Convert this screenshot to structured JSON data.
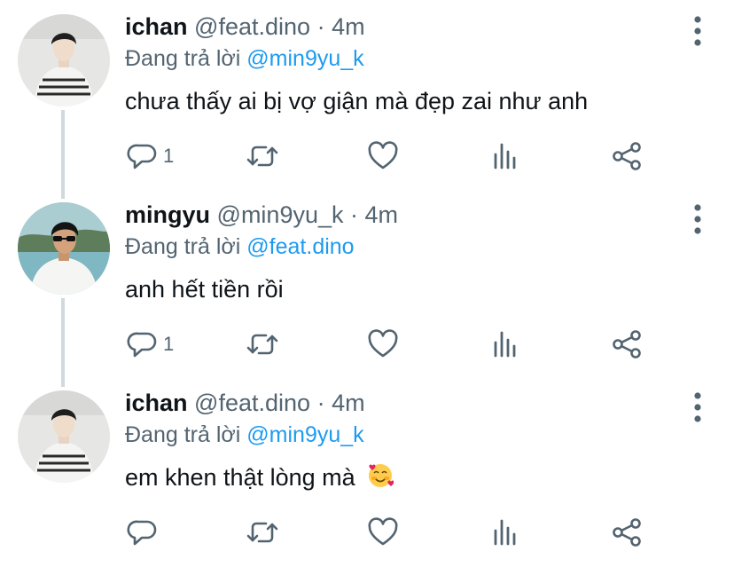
{
  "colors": {
    "text": "#0f1419",
    "muted": "#536471",
    "link": "#1d9bf0",
    "thread_line": "#cfd9de",
    "icon": "#536471"
  },
  "replying_label": "Đang trả lời",
  "tweets": [
    {
      "name": "ichan",
      "handle": "@feat.dino",
      "sep": "·",
      "time": "4m",
      "reply_to": "@min9yu_k",
      "text": "chưa thấy ai bị vợ giận mà đẹp zai như anh",
      "emoji": "",
      "reply_count": "1",
      "icons": [
        "more-icon",
        "reply-icon",
        "retweet-icon",
        "like-icon",
        "stats-icon",
        "share-icon"
      ]
    },
    {
      "name": "mingyu",
      "handle": "@min9yu_k",
      "sep": "·",
      "time": "4m",
      "reply_to": "@feat.dino",
      "text": "anh hết tiền rồi",
      "emoji": "",
      "reply_count": "1",
      "icons": [
        "more-icon",
        "reply-icon",
        "retweet-icon",
        "like-icon",
        "stats-icon",
        "share-icon"
      ]
    },
    {
      "name": "ichan",
      "handle": "@feat.dino",
      "sep": "·",
      "time": "4m",
      "reply_to": "@min9yu_k",
      "text": "em khen thật lòng mà",
      "emoji": "smiling-face-with-hearts",
      "reply_count": "",
      "icons": [
        "more-icon",
        "reply-icon",
        "retweet-icon",
        "like-icon",
        "stats-icon",
        "share-icon"
      ]
    }
  ]
}
